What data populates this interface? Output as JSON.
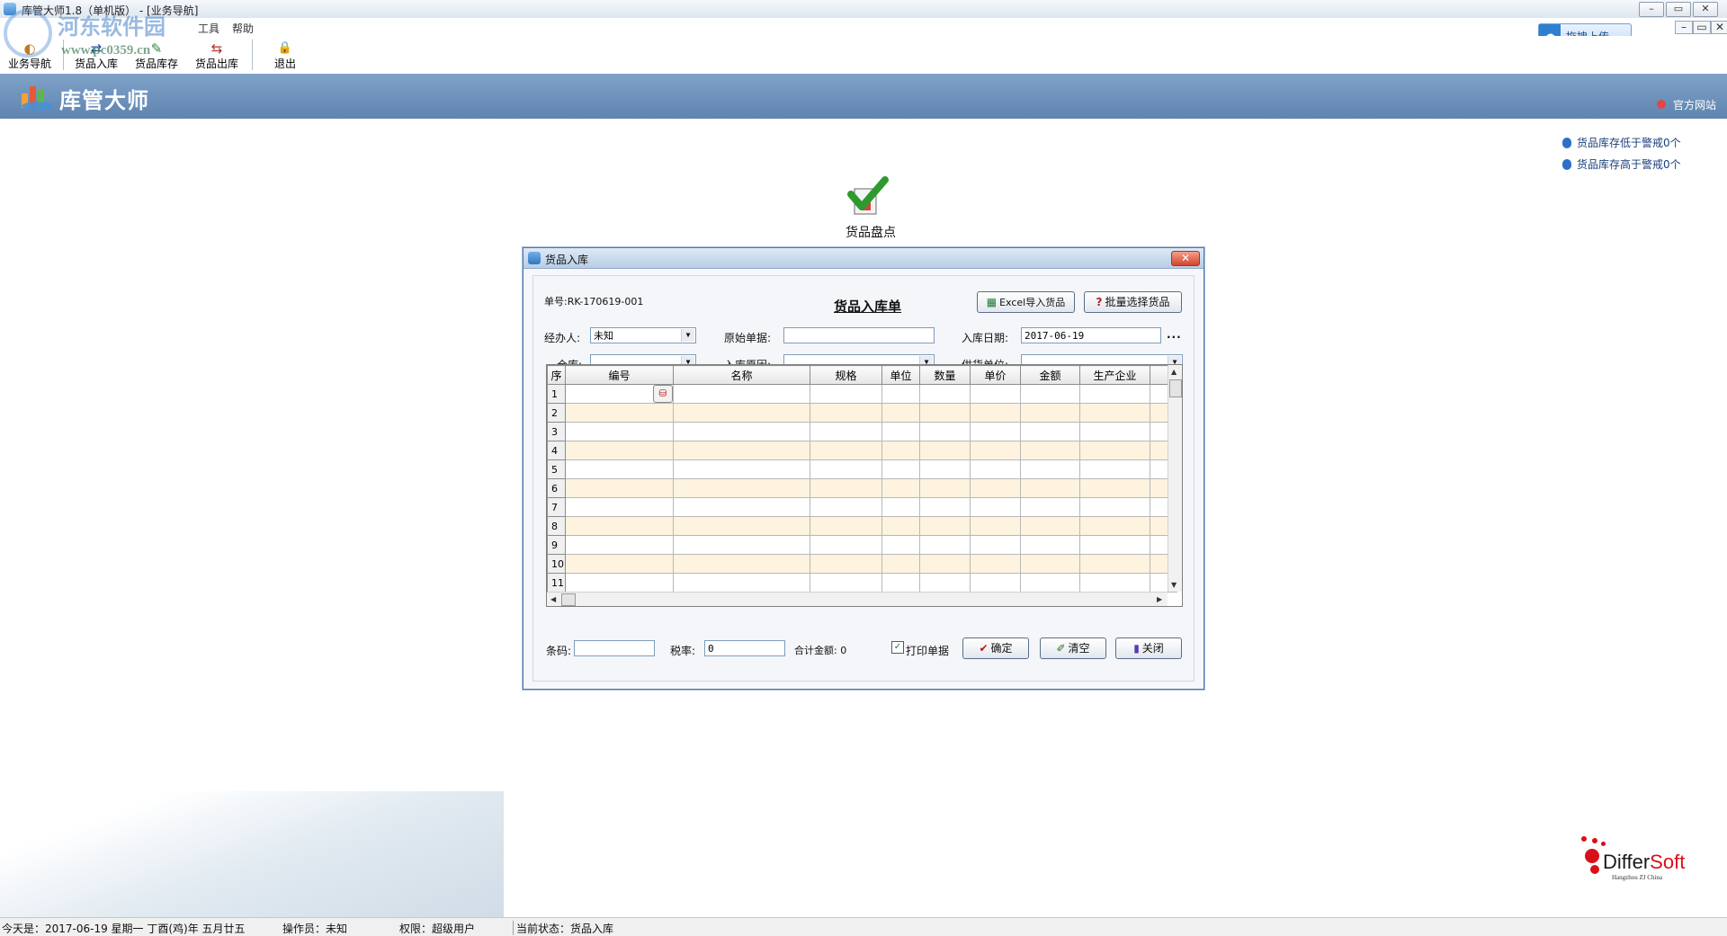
{
  "window": {
    "title": "库管大师1.8（单机版） - [业务导航]",
    "controls": {
      "minimize": "–",
      "maximize": "▭",
      "close": "✕"
    }
  },
  "menu": {
    "items": [
      "工具",
      "帮助"
    ]
  },
  "toolbar": {
    "items": [
      {
        "label": "业务导航",
        "icon": "navigation-icon",
        "glyph": "◐"
      },
      {
        "label": "货品入库",
        "icon": "stock-in-icon",
        "glyph": "⇄"
      },
      {
        "label": "货品库存",
        "icon": "inventory-icon",
        "glyph": "✎"
      },
      {
        "label": "货品出库",
        "icon": "stock-out-icon",
        "glyph": "⇆"
      },
      {
        "label": "退出",
        "icon": "exit-lock-icon",
        "glyph": "🔒"
      }
    ]
  },
  "cloud_upload": {
    "label": "拖拽上传",
    "icon": "cloud-icon"
  },
  "banner": {
    "app_name": "库管大师",
    "site_link": "官方网站"
  },
  "alerts": [
    "货品库存低于警戒0个",
    "货品库存高于警戒0个"
  ],
  "center_icon": {
    "label": "货品盘点",
    "icon": "check-inventory-icon"
  },
  "dialog": {
    "title": "货品入库",
    "close": "✕",
    "order_no": "单号:RK-170619-001",
    "form_title": "货品入库单",
    "excel_button": "Excel导入货品",
    "batch_button": "批量选择货品",
    "fields": {
      "handler_label": "经办人:",
      "handler_value": "未知",
      "original_doc_label": "原始单据:",
      "original_doc_value": "",
      "date_label": "入库日期:",
      "date_value": "2017-06-19",
      "date_more": "...",
      "warehouse_label": "仓库:",
      "warehouse_value": "",
      "reason_label": "入库原因:",
      "reason_value": "",
      "supplier_label": "供货单位:",
      "supplier_value": ""
    },
    "grid": {
      "columns": [
        "序",
        "编号",
        "名称",
        "规格",
        "单位",
        "数量",
        "单价",
        "金额",
        "生产企业"
      ],
      "rows": [
        "1",
        "2",
        "3",
        "4",
        "5",
        "6",
        "7",
        "8",
        "9",
        "10",
        "11"
      ]
    },
    "footer": {
      "barcode_label": "条码:",
      "barcode_value": "",
      "tax_label": "税率:",
      "tax_value": "0",
      "total_label": "合计金额: 0",
      "print_label": "打印单据",
      "print_checked": true,
      "confirm": "确定",
      "clear": "清空",
      "close": "关闭"
    }
  },
  "watermark": {
    "line1": "河东软件园",
    "line2": "www.pc0359.cn"
  },
  "brand": {
    "name_black": "Differ",
    "name_red": "Soft",
    "sub": "Hangzhou ZJ China"
  },
  "statusbar": {
    "date": "今天是：2017-06-19 星期一 丁酉(鸡)年 五月廿五",
    "operator": "操作员：未知",
    "permission": "权限：超级用户",
    "state": "当前状态：货品入库"
  }
}
